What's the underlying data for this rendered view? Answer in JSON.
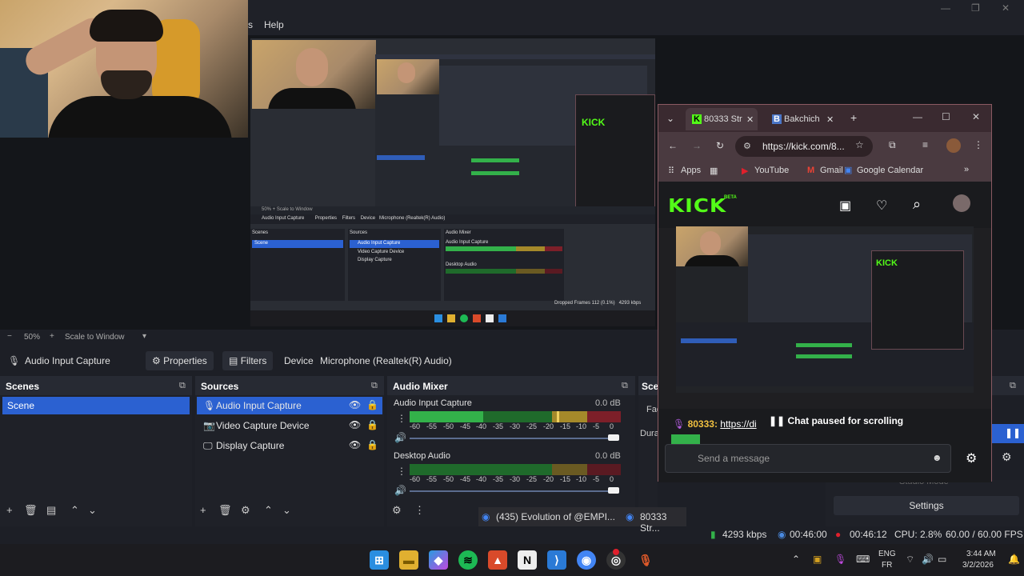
{
  "menu": {
    "help": "Help"
  },
  "zoom": {
    "minus": "−",
    "value": "50%",
    "plus": "+",
    "mode": "Scale to Window"
  },
  "source_bar": {
    "selected_source": "Audio Input Capture",
    "properties": "Properties",
    "filters": "Filters",
    "device_label": "Device",
    "device_value": "Microphone (Realtek(R) Audio)"
  },
  "scenes": {
    "title": "Scenes",
    "items": [
      "Scene"
    ]
  },
  "sources": {
    "title": "Sources",
    "items": [
      "Audio Input Capture",
      "Video Capture Device",
      "Display Capture"
    ]
  },
  "mixer": {
    "title": "Audio Mixer",
    "channels": [
      {
        "name": "Audio Input Capture",
        "db": "0.0 dB"
      },
      {
        "name": "Desktop Audio",
        "db": "0.0 dB"
      }
    ],
    "scale": [
      "-60",
      "-55",
      "-50",
      "-45",
      "-40",
      "-35",
      "-30",
      "-25",
      "-20",
      "-15",
      "-10",
      "-5",
      "0"
    ]
  },
  "scene_transitions": {
    "title_partial": "Sce",
    "fade_partial": "Fad",
    "duration_partial": "Dura"
  },
  "controls": {
    "studio_mode": "Studio Mode",
    "settings": "Settings"
  },
  "status": {
    "bitrate": "4293 kbps",
    "stream_time": "00:46:00",
    "rec_time": "00:46:12",
    "cpu": "CPU: 2.8%",
    "fps": "60.00 / 60.00 FPS"
  },
  "taskbar_popup": {
    "item1": "(435) Evolution of @EMPI...",
    "item2": "80333 Str..."
  },
  "tray": {
    "lang1": "ENG",
    "lang2": "FR",
    "time": "3:44 AM",
    "date": "3/2/2026"
  },
  "browser": {
    "tab1": "80333 Str",
    "tab2": "Bakchich",
    "url": "https://kick.com/8...",
    "bookmarks": [
      "Apps",
      "YouTube",
      "Gmail",
      "Google Calendar"
    ],
    "kick_logo": "KICK",
    "kick_beta": "BETA",
    "chat_user": "80333:",
    "chat_link": "https://di",
    "chat_paused": "Chat paused for scrolling",
    "send_placeholder": "Send a message"
  },
  "colors": {
    "kick_green": "#53fc18",
    "obs_select": "#2b61d1",
    "rec_red": "#e0202c"
  }
}
